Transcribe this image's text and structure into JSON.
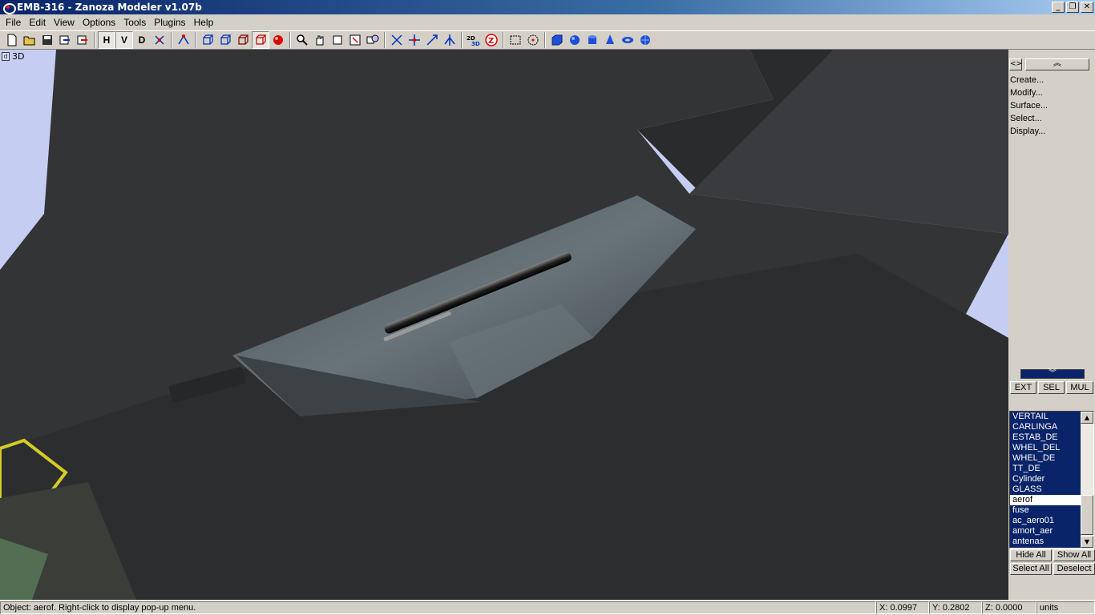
{
  "window": {
    "title": "EMB-316 - Zanoza Modeler v1.07b",
    "controls": {
      "minimize": "_",
      "maximize": "❐",
      "close": "✕"
    }
  },
  "menu": {
    "items": [
      "File",
      "Edit",
      "View",
      "Options",
      "Tools",
      "Plugins",
      "Help"
    ]
  },
  "toolbar": {
    "view_h": "H",
    "view_v": "V",
    "view_d": "D",
    "icons": {
      "new": "🗋",
      "open": "📂",
      "save": "💾",
      "zoom": "🔍",
      "pan": "✋"
    }
  },
  "viewport": {
    "label": "3D",
    "colors": {
      "sky": "#c5cdf2",
      "dark": "#2e2f31",
      "mid": "#3d3e41",
      "panel": "#596267",
      "cockpit": "#d4cc27"
    }
  },
  "side_panel": {
    "toggle_label": "<>",
    "collapse_label": "︽",
    "expand_label": "︾",
    "menu": [
      "Create...",
      "Modify...",
      "Surface...",
      "Select...",
      "Display..."
    ],
    "modes": [
      "EXT",
      "SEL",
      "MUL"
    ],
    "objects": [
      "VERTAIL",
      "CARLINGA",
      "ESTAB_DE",
      "WHEL_DEL",
      "WHEL_DE",
      "TT_DE",
      "Cylinder",
      "GLASS",
      "aerof",
      "fuse",
      "ac_aero01",
      "amort_aer",
      "antenas"
    ],
    "current_object": "aerof",
    "scroll_up": "▲",
    "scroll_down": "▼",
    "actions": [
      "Hide All",
      "Show All",
      "Select All",
      "Deselect"
    ]
  },
  "status": {
    "message": "Object: aerof. Right-click to display pop-up menu.",
    "x": "X: 0.0997",
    "y": "Y: 0.2802",
    "z": "Z: 0.0000",
    "units": "units"
  }
}
